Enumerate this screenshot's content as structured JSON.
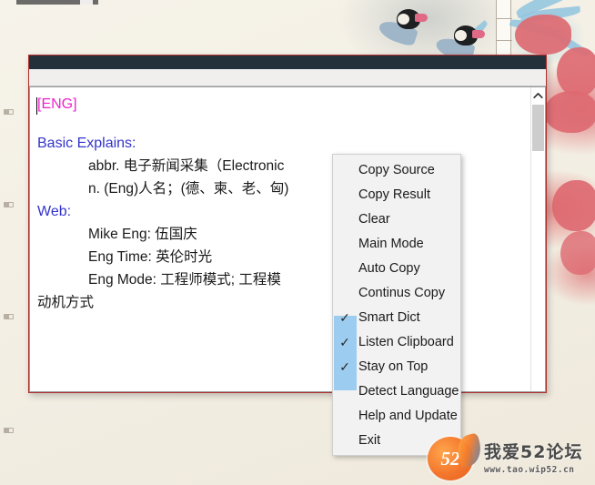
{
  "window": {
    "title": "",
    "title_bar_color": "#25313a",
    "border_color": "#b03030"
  },
  "translation": {
    "query_tag": "[ENG]",
    "query_tag_color": "#ee22cc",
    "section_basic_label": "Basic Explains:",
    "section_web_label": "Web:",
    "heading_color": "#3333cc",
    "basic_entries": [
      "abbr. 电子新闻采集（Electronic",
      "n. (Eng)人名；(德、柬、老、匈)"
    ],
    "web_entries": [
      "Mike Eng: 伍国庆",
      "Eng Time: 英伦时光",
      "Eng Mode: 工程师模式; 工程模"
    ],
    "wrapped_tail": "动机方式"
  },
  "scrollbar": {
    "up_arrow_icon": "chevron-up-icon",
    "thumb_color": "#cdcdcd"
  },
  "context_menu": {
    "highlight_color": "#9ccdf0",
    "check_glyph": "✓",
    "items": [
      {
        "label": "Copy Source",
        "checked": false
      },
      {
        "label": "Copy Result",
        "checked": false
      },
      {
        "label": "Clear",
        "checked": false
      },
      {
        "label": "Main Mode",
        "checked": false
      },
      {
        "label": "Auto Copy",
        "checked": false
      },
      {
        "label": "Continus Copy",
        "checked": false
      },
      {
        "label": "Smart Dict",
        "checked": true
      },
      {
        "label": "Listen Clipboard",
        "checked": true
      },
      {
        "label": "Stay on Top",
        "checked": true
      },
      {
        "label": "Detect Language",
        "checked": false
      },
      {
        "label": "Help and Update",
        "checked": false
      },
      {
        "label": "Exit",
        "checked": false
      }
    ]
  },
  "watermark": {
    "emblem_text": "52",
    "title": "我爱52论坛",
    "url": "www.tao.wip52.cn"
  }
}
